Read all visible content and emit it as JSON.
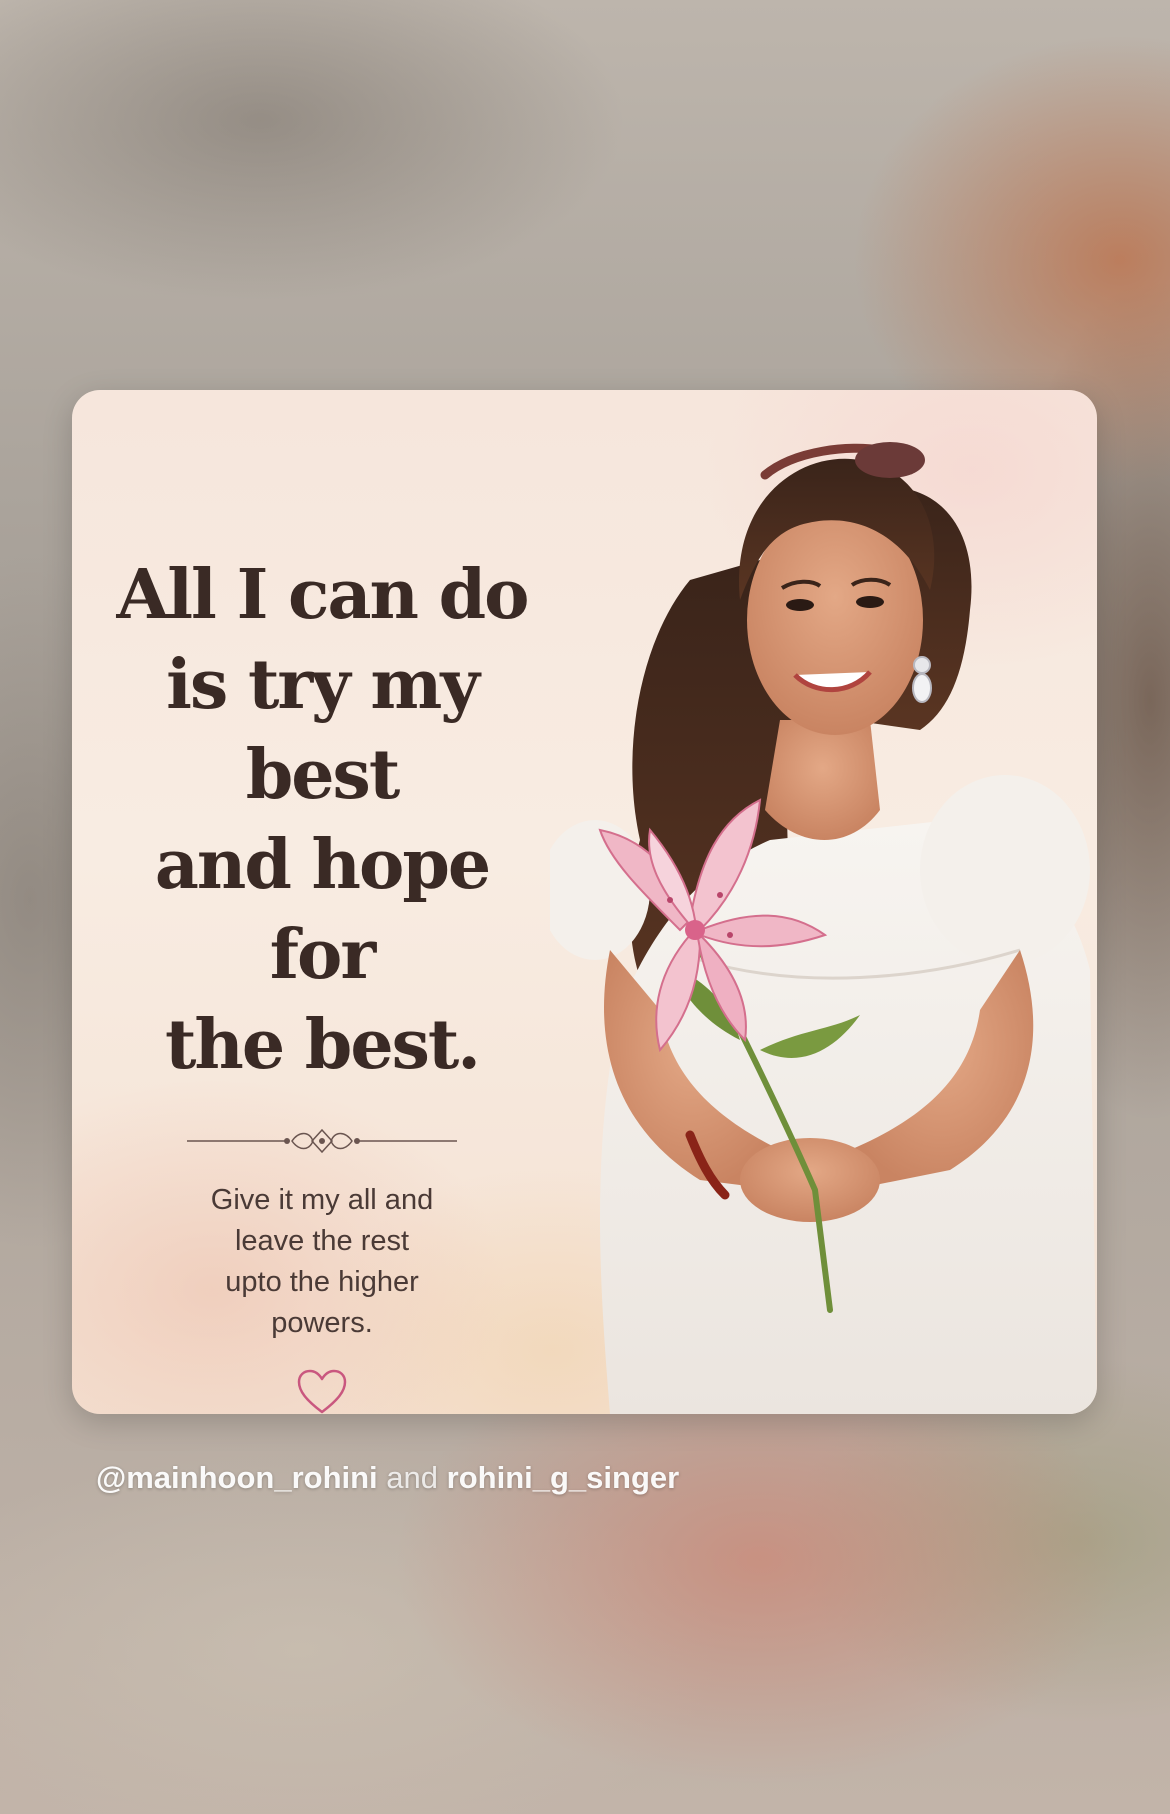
{
  "quote": {
    "headline": "All I can do\nis try my best\nand hope for\nthe best.",
    "subtext": "Give it my all and\nleave the rest\nupto the higher\npowers."
  },
  "mentions": {
    "first": "@mainhoon_rohini",
    "conjunction": "and",
    "second": "rohini_g_singer"
  },
  "icons": {
    "divider": "flourish-divider-icon",
    "heart": "heart-outline-icon",
    "flower": "lily-flower-icon"
  },
  "colors": {
    "headline": "#3a2a25",
    "heart": "#c9577f",
    "card_background": "#f6e6dc",
    "dress": "#f3efea"
  }
}
